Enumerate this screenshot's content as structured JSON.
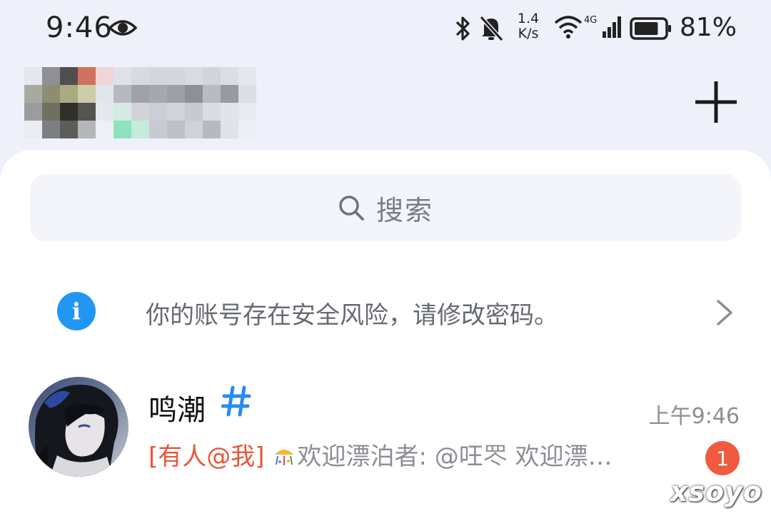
{
  "status_bar": {
    "time": "9:46",
    "net_speed_value": "1.4",
    "net_speed_unit": "K/s",
    "network_type": "4G",
    "battery_percent": "81%",
    "battery_level": 0.81,
    "icons": [
      "eye-icon",
      "bluetooth-icon",
      "bell-muted-icon",
      "wifi-icon",
      "signal-icon",
      "battery-icon"
    ]
  },
  "header": {
    "add_icon": "plus-icon"
  },
  "search": {
    "placeholder": "搜索"
  },
  "security_banner": {
    "text": "你的账号存在安全风险，请修改密码。",
    "info_icon_glyph": "i"
  },
  "conversations": [
    {
      "name": "鸣潮",
      "time": "上午9:46",
      "mention_tag": "[有人@我]",
      "preview": "欢迎漂泊者: @㕵罖 欢迎漂…",
      "unread_count": "1"
    }
  ],
  "watermark": "xsoyo",
  "colors": {
    "background": "#eef1f9",
    "accent_blue": "#2196f3",
    "mention_red": "#e8563a",
    "badge_red": "#f05a3f",
    "muted_text": "#8b8e94"
  }
}
